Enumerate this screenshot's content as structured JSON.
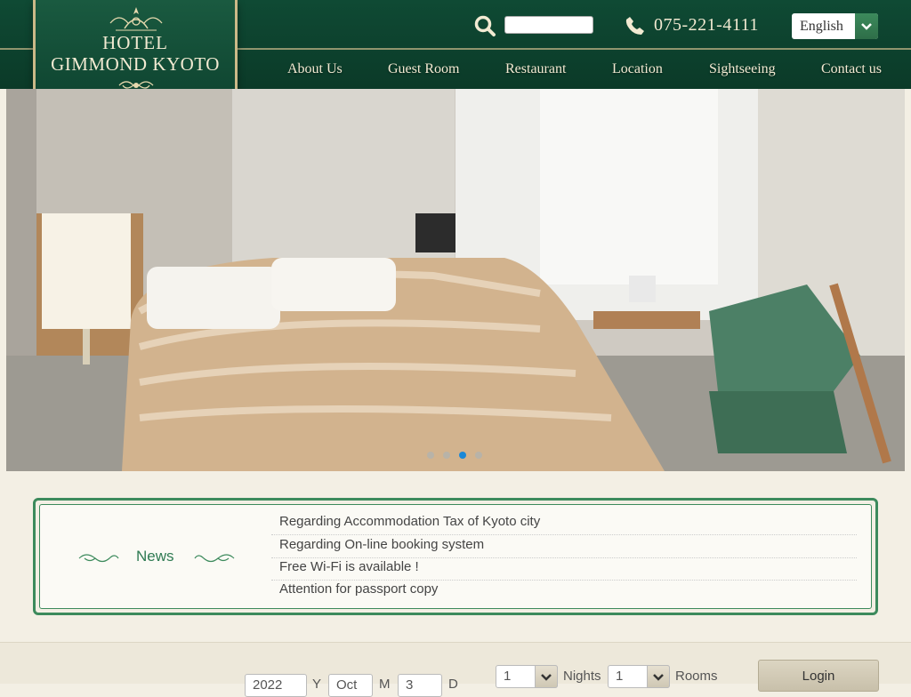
{
  "header": {
    "logo": {
      "line1": "HOTEL",
      "line2": "GIMMOND KYOTO"
    },
    "phone": "075-221-4111",
    "language": "English",
    "nav": [
      "About Us",
      "Guest Room",
      "Restaurant",
      "Location",
      "Sightseeing",
      "Contact us"
    ]
  },
  "hero": {
    "slide_count": 4,
    "active_slide": 3
  },
  "news": {
    "title": "News",
    "items": [
      "Regarding Accommodation Tax of Kyoto city",
      "Regarding On-line booking system",
      "Free Wi-Fi is available !",
      "Attention for passport copy"
    ]
  },
  "booking": {
    "year": "2022",
    "year_label": "Y",
    "month": "Oct",
    "month_label": "M",
    "day": "3",
    "day_label": "D",
    "nights": "1",
    "nights_label": "Nights",
    "rooms": "1",
    "rooms_label": "Rooms",
    "login_label": "Login"
  },
  "colors": {
    "brand_green": "#0f4a34",
    "accent_gold": "#cbb988",
    "news_green": "#3c8a5c",
    "active_dot": "#1a88d8"
  }
}
